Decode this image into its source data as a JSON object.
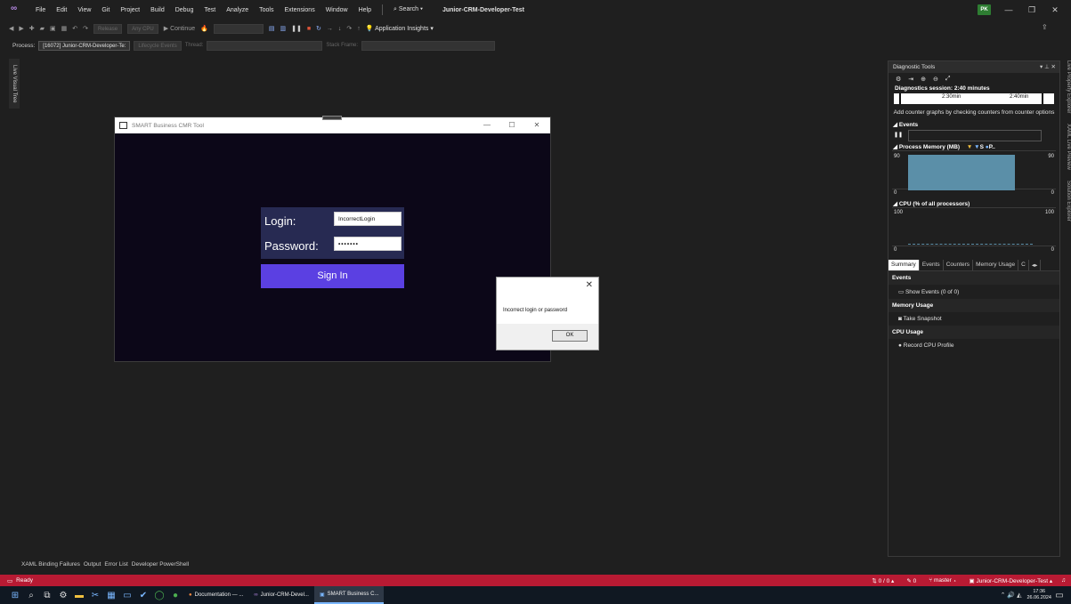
{
  "menubar": {
    "items": [
      "File",
      "Edit",
      "View",
      "Git",
      "Project",
      "Build",
      "Debug",
      "Test",
      "Analyze",
      "Tools",
      "Extensions",
      "Window",
      "Help"
    ],
    "search": "Search",
    "project_title": "Junior-CRM-Developer-Test",
    "avatar": "PK"
  },
  "toolbar1": {
    "config": "Release",
    "platform": "Any CPU",
    "continue": "Continue",
    "app_insights": "Application Insights"
  },
  "toolbar2": {
    "process_label": "Process:",
    "process_value": "[16072] Junior-CRM-Developer-Te:",
    "lifecycle": "Lifecycle Events",
    "thread": "Thread:",
    "stack_frame": "Stack Frame:"
  },
  "left_tab": "Live Visual Tree",
  "app_window": {
    "title": "SMART Business CMR Tool",
    "login_label": "Login:",
    "login_value": "IncorrectLogin",
    "password_label": "Password:",
    "password_value": "•••••••",
    "signin_label": "Sign In"
  },
  "message_box": {
    "message": "Incorrect login or password",
    "ok_label": "OK"
  },
  "diagnostics": {
    "title": "Diagnostic Tools",
    "session": "Diagnostics session: 2:40 minutes",
    "time_ticks": [
      "2:30min",
      "2:40min"
    ],
    "counter_note": "Add counter graphs by checking counters from counter options",
    "events_section": "Events",
    "memory_section": "Process Memory (MB)",
    "memory_legend": [
      "S",
      "P.."
    ],
    "memory_max": "90",
    "memory_min": "0",
    "cpu_section": "CPU (% of all processors)",
    "cpu_max": "100",
    "cpu_min": "0",
    "tabs": [
      "Summary",
      "Events",
      "Counters",
      "Memory Usage",
      "C"
    ],
    "events_header": "Events",
    "show_events": "Show Events (0 of 0)",
    "memory_header": "Memory Usage",
    "take_snapshot": "Take Snapshot",
    "cpu_header": "CPU Usage",
    "record_cpu": "Record CPU Profile"
  },
  "right_tabs": [
    "Live Property Explorer",
    "XAML Live Preview",
    "Solution Explorer"
  ],
  "bottom_tabs": [
    "XAML Binding Failures",
    "Output",
    "Error List",
    "Developer PowerShell"
  ],
  "status": {
    "ready": "Ready",
    "changes": "0 / 0",
    "pencil": "0",
    "branch": "master",
    "repo": "Junior-CRM-Developer-Test"
  },
  "taskbar": {
    "apps": [
      "Documentation — ...",
      "Junior-CRM-Devel...",
      "SMART Business C..."
    ],
    "time": "17:36",
    "date": "26.06.2024"
  },
  "colors": {
    "accent": "#5b40e2",
    "panel": "#272a52",
    "status_bar": "#b81a33",
    "memory_fill": "#5b8fa8"
  }
}
